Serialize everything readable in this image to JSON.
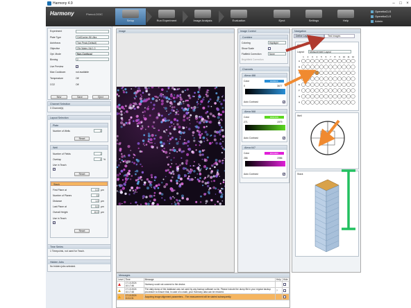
{
  "window": {
    "title": "Harmony 4.9"
  },
  "toolbar": {
    "logo": "Harmony",
    "logo_sub": "PhenoLOGIC",
    "nav": [
      "Setup",
      "Run Experiment",
      "Image Analysis",
      "Evaluation",
      "Eject",
      "Settings",
      "Help"
    ],
    "user_items": [
      "OperettaCLS",
      "OperettaCLS",
      "Admin"
    ]
  },
  "left": {
    "experiment_label": "Experiment",
    "rows": [
      {
        "label": "Plate Type",
        "value": "CellCarrier-96 Ultra"
      },
      {
        "label": "Autofocus",
        "value": "Two Peak (Default)"
      },
      {
        "label": "Objective",
        "value": "20x Water, NA 1.0"
      },
      {
        "label": "Opt. Mode",
        "value": "Non-Confocal"
      },
      {
        "label": "Binning",
        "value": "2"
      }
    ],
    "live_preview": "Live Preview",
    "max_cooldown": {
      "label": "Max Cooldown",
      "value": "not available"
    },
    "temperature": {
      "label": "Temperature",
      "value": "Off"
    },
    "co2": {
      "label": "CO2",
      "value": "Off"
    },
    "buttons": [
      "New",
      "Save",
      "Eject"
    ],
    "channel_selection": {
      "title": "Channel Selection",
      "info": "3 Channel(s)"
    },
    "layout_selection": "Layout Selection",
    "plate": {
      "title": "Plate",
      "wells_label": "Number of Wells",
      "wells_value": "0",
      "reset": "Reset"
    },
    "well": {
      "title": "Well",
      "fields_label": "Number of Fields",
      "fields_value": "1",
      "overlap_label": "Overlap",
      "overlap_value": "0",
      "overlap_unit": "%",
      "useinteach": "Use in Teach",
      "reset": "Reset"
    },
    "stack": {
      "title": "Stack",
      "rows": [
        {
          "label": "First Plane at",
          "value": "0.0",
          "unit": "µm"
        },
        {
          "label": "Number of Planes",
          "value": "11",
          "unit": ""
        },
        {
          "label": "Distance",
          "value": "1.0",
          "unit": "µm"
        },
        {
          "label": "Last Plane at",
          "value": "5.0",
          "unit": "µm"
        },
        {
          "label": "Overall Height",
          "value": "10.0",
          "unit": "µm"
        }
      ],
      "useinteach": "Use in Teach",
      "reset": "Reset"
    },
    "time_series": {
      "title": "Time Series",
      "info": "1 Timepoints, not used for Teach."
    },
    "hidden_jobs": {
      "title": "Hidden Jobs",
      "info": "No hidden jobs selected."
    }
  },
  "image": {
    "title": "Image"
  },
  "imgctrl": {
    "title": "Image Control",
    "combine": "Combine",
    "coloring": {
      "label": "Coloring",
      "value": "Highlight"
    },
    "show_scale": "Show Scale",
    "flatfield": {
      "label": "Flatfield Correction",
      "value": "None"
    },
    "brightfield": "Brightfield Correction",
    "channels_title": "Channels",
    "channels": [
      {
        "name": "Alexa 488",
        "color_hex": "#2a8fd6",
        "color_label": "#0080FF",
        "min": "0",
        "max": "3677",
        "auto": "Auto Contrast"
      },
      {
        "name": "Alexa 568",
        "color_hex": "#5cd820",
        "color_label": "#00FF00",
        "min": "271",
        "max": "1979",
        "auto": "Auto Contrast"
      },
      {
        "name": "Alexa 647",
        "color_hex": "#e020d8",
        "color_label": "#FF00FF",
        "min": "286",
        "max": "1986",
        "auto": "Auto Contrast"
      }
    ]
  },
  "navigation": {
    "title": "Navigation",
    "tabs": [
      "Define Layout",
      "Test Images"
    ],
    "array_label": "Array",
    "layout_label": "Layout",
    "layout_value": "Measurement Layout",
    "well_label": "Well",
    "stack_label": "Stack",
    "plate_cols": [
      "1",
      "2",
      "3",
      "4",
      "5",
      "6",
      "7",
      "8",
      "9",
      "10",
      "11",
      "12"
    ],
    "plate_rows": [
      "A",
      "B",
      "C",
      "D",
      "E",
      "F",
      "G",
      "H"
    ]
  },
  "messages": {
    "title": "Messages",
    "headers": [
      "Level",
      "Time",
      "Message",
      "Help",
      "Hide"
    ],
    "rows": [
      {
        "time": "17.10.2024 10:17:46",
        "text": "Harmony could not connect to the device."
      },
      {
        "time": "17.10.2024 10:17:48",
        "text": "The daily dump of the database was not used by any backup software so far. Please include the dump file in your regular backup procedure to ensure that, in case of a crash, your Harmony data can be restored."
      },
      {
        "time": "17.10.2024 11:11:31",
        "text": "Acquiring image alignment parameters... The measurement will be started subsequently."
      }
    ]
  },
  "annotations": {
    "arrow1": "#b03a2e",
    "arrow2": "#f08a30",
    "bracket": "#22c060"
  }
}
